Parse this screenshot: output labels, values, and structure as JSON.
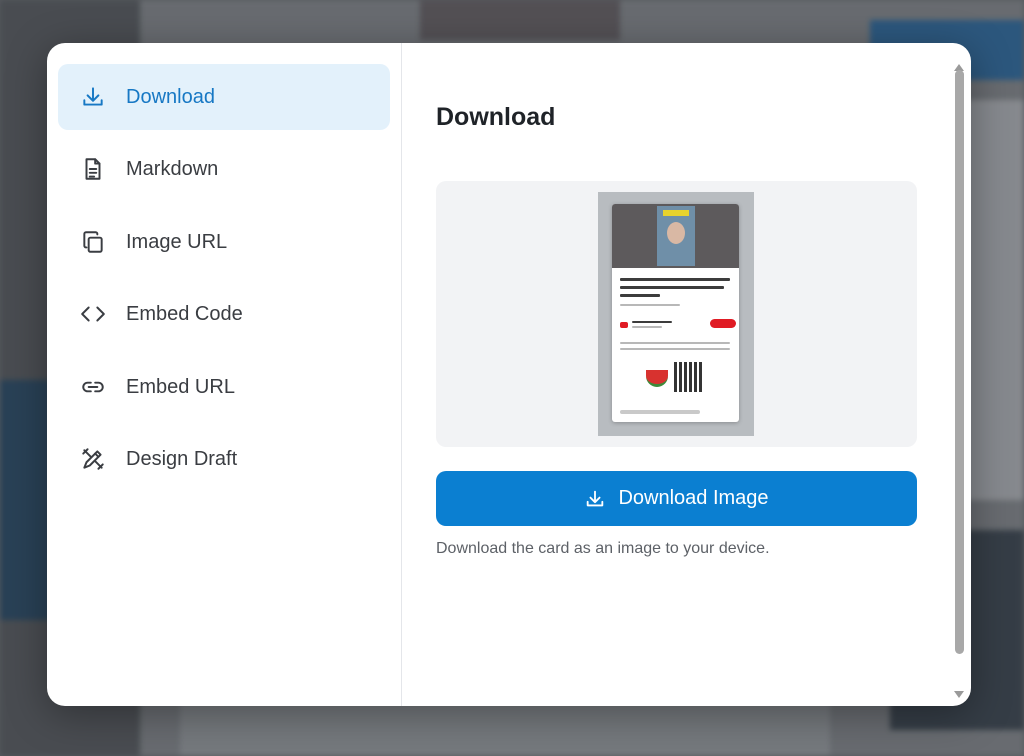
{
  "sidebar": {
    "items": [
      {
        "label": "Download",
        "icon": "download-icon",
        "active": true
      },
      {
        "label": "Markdown",
        "icon": "document-icon",
        "active": false
      },
      {
        "label": "Image URL",
        "icon": "copy-icon",
        "active": false
      },
      {
        "label": "Embed Code",
        "icon": "code-icon",
        "active": false
      },
      {
        "label": "Embed URL",
        "icon": "link-icon",
        "active": false
      },
      {
        "label": "Design Draft",
        "icon": "design-icon",
        "active": false
      }
    ]
  },
  "panel": {
    "title": "Download",
    "close_icon": "close-icon",
    "download_button": "Download Image",
    "description": "Download the card as an image to your device."
  },
  "colors": {
    "accent": "#0b7fd1",
    "active_bg": "#e3f1fb",
    "active_text": "#1778c4"
  }
}
